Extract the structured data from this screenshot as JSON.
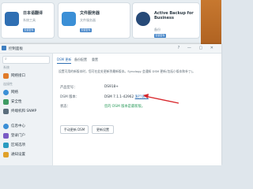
{
  "packages": [
    {
      "name": "日本语翻译",
      "category": "系统工具",
      "button": "安装套件",
      "icon": "translate-icon",
      "color": "#2f6fb3"
    },
    {
      "name": "文件服务器",
      "category": "文件服务器",
      "button": "安装套件",
      "icon": "file-server-icon",
      "color": "#3b8fd6"
    },
    {
      "name": "Active Backup for",
      "name2": "Business",
      "category": "备份",
      "button": "安装套件",
      "icon": "backup-icon",
      "color": "#274a78"
    }
  ],
  "window": {
    "title": "控制面板",
    "controls": "? — ▢ ✕"
  },
  "sidebar": {
    "search_icon": "⌕",
    "sections": [
      "系统",
      "连接性"
    ],
    "items": [
      {
        "label": "网络接口",
        "icon": "network-icon",
        "color": "#e07b2a"
      },
      {
        "label": "网络",
        "icon": "globe-icon",
        "color": "#3b8fd6"
      },
      {
        "label": "安全性",
        "icon": "shield-icon",
        "color": "#3e9b63"
      },
      {
        "label": "终端机和 SNMP",
        "icon": "terminal-icon",
        "color": "#5a6d7c"
      },
      {
        "label": "信息中心",
        "icon": "info-icon",
        "color": "#3b8fd6"
      },
      {
        "label": "登录门户",
        "icon": "portal-icon",
        "color": "#7a5bc4"
      },
      {
        "label": "区域选项",
        "icon": "region-icon",
        "color": "#2a9bc0"
      },
      {
        "label": "通知设置",
        "icon": "bell-icon",
        "color": "#e0a12a"
      }
    ]
  },
  "tabs": [
    "DSM 更新",
    "备份配置",
    "重置"
  ],
  "description": "设置可用的新版本时，您可在此处更新到最新版本。Synology 会通知 DSM 更新(包括小版本和补丁)。",
  "info": {
    "product_label": "产品型号：",
    "product_value": "DS918+",
    "dsm_label": "DSM 版本：",
    "dsm_value": "DSM 7.1.1-42962",
    "release_notes": "发行说明",
    "status_label": "状态：",
    "status_value": "您的 DSM 版本是最新版。"
  },
  "buttons": {
    "manual_update": "手动更新 DSM",
    "update_settings": "更新设置"
  },
  "annotation_color": "#d8262b"
}
